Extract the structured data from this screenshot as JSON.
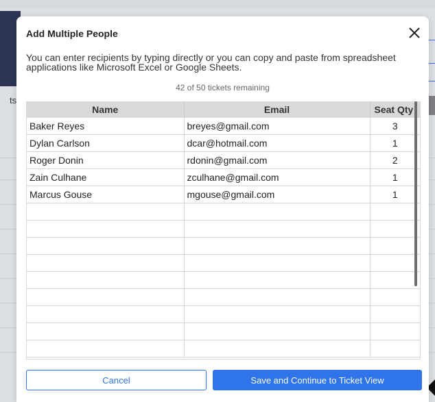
{
  "background": {
    "partial_text": "ts"
  },
  "modal": {
    "title": "Add Multiple People",
    "description": "You can enter recipients by typing directly or you can copy and paste from spreadsheet applications like Microsoft Excel or Google Sheets.",
    "tickets_remaining": "42 of 50 tickets remaining",
    "close_icon": "close-icon"
  },
  "grid": {
    "columns": [
      "Name",
      "Email",
      "Seat Qty"
    ],
    "rows": [
      {
        "name": "Baker Reyes",
        "email": "breyes@gmail.com",
        "qty": "3"
      },
      {
        "name": "Dylan Carlson",
        "email": "dcar@hotmail.com",
        "qty": "1"
      },
      {
        "name": "Roger Donin",
        "email": "rdonin@gmail.com",
        "qty": "2"
      },
      {
        "name": "Zain Culhane",
        "email": "zculhane@gmail.com",
        "qty": "1"
      },
      {
        "name": "Marcus Gouse",
        "email": "mgouse@gmail.com",
        "qty": "1"
      }
    ]
  },
  "buttons": {
    "cancel": "Cancel",
    "save": "Save and Continue to Ticket View"
  },
  "colors": {
    "accent": "#2f74ea",
    "header_bg": "#d9d9d9",
    "navy": "#2c3554"
  }
}
